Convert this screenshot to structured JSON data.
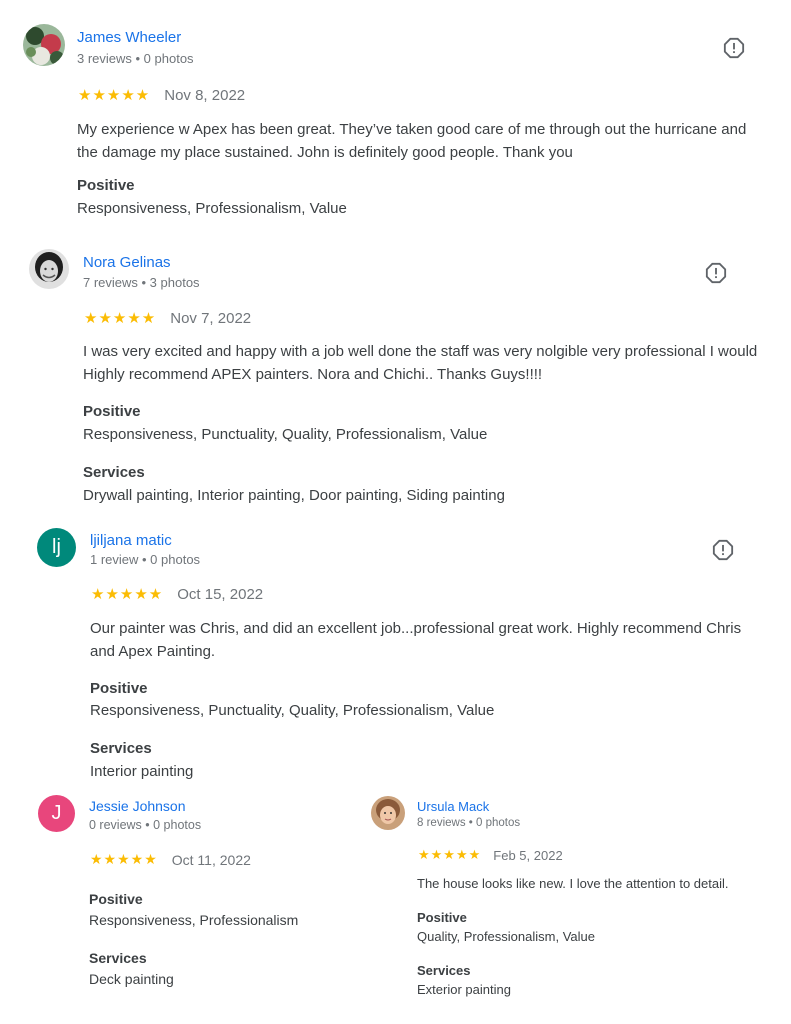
{
  "reviews": [
    {
      "name": "James Wheeler",
      "meta": "3 reviews • 0 photos",
      "stars": "★★★★★",
      "rating": 5,
      "date": "Nov 8, 2022",
      "text": "My experience w Apex has been great. They’ve taken good care of me through out the hurricane and the damage my place sustained. John is definitely good people. Thank you",
      "positive_label": "Positive",
      "positive": "Responsiveness, Professionalism, Value",
      "avatar_icon": "photo-avatar"
    },
    {
      "name": "Nora Gelinas",
      "meta": "7 reviews • 3 photos",
      "stars": "★★★★★",
      "rating": 5,
      "date": "Nov 7, 2022",
      "text": "I was very excited and happy with a job well done the staff was very nolgible very professional I would Highly recommend APEX painters. Nora and Chichi.. Thanks Guys!!!!",
      "positive_label": "Positive",
      "positive": "Responsiveness, Punctuality, Quality, Professionalism, Value",
      "services_label": "Services",
      "services": "Drywall painting, Interior painting, Door painting, Siding painting",
      "avatar_icon": "photo-avatar"
    },
    {
      "name": "ljiljana matic",
      "meta": "1 review • 0 photos",
      "stars": "★★★★★",
      "rating": 5,
      "date": "Oct 15, 2022",
      "text": "Our painter was Chris, and did an excellent job...professional great work. Highly recommend Chris and Apex Painting.",
      "positive_label": "Positive",
      "positive": "Responsiveness, Punctuality, Quality, Professionalism, Value",
      "services_label": "Services",
      "services": "Interior painting",
      "avatar_letter": "lj",
      "avatar_color": "#00897b"
    },
    {
      "name": "Jessie Johnson",
      "meta": "0 reviews • 0 photos",
      "stars": "★★★★★",
      "rating": 5,
      "date": "Oct 11, 2022",
      "positive_label": "Positive",
      "positive": "Responsiveness, Professionalism",
      "services_label": "Services",
      "services": "Deck painting",
      "avatar_letter": "J",
      "avatar_color": "#e8467c"
    },
    {
      "name": "Ursula Mack",
      "meta": "8 reviews • 0 photos",
      "stars": "★★★★★",
      "rating": 5,
      "date": "Feb 5, 2022",
      "text": "The house looks like new. I love the attention to detail.",
      "positive_label": "Positive",
      "positive": "Quality, Professionalism, Value",
      "services_label": "Services",
      "services": "Exterior painting",
      "avatar_icon": "photo-avatar"
    }
  ],
  "colors": {
    "link": "#1a73e8",
    "star": "#fbbc04",
    "text": "#3c4043",
    "secondary": "#70757a"
  },
  "report_icon": "report-flag-icon"
}
